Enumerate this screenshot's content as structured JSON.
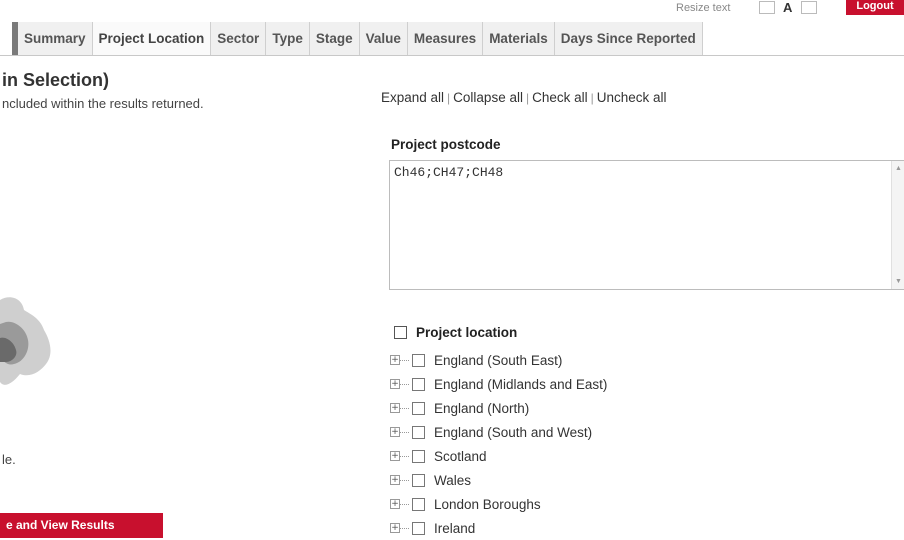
{
  "header": {
    "resize_label": "Resize text",
    "resize_a": "A",
    "logout_label": "Logout"
  },
  "tabs": [
    {
      "label": "Summary"
    },
    {
      "label": "Project Location"
    },
    {
      "label": "Sector"
    },
    {
      "label": "Type"
    },
    {
      "label": "Stage"
    },
    {
      "label": "Value"
    },
    {
      "label": "Measures"
    },
    {
      "label": "Materials"
    },
    {
      "label": "Days Since Reported"
    }
  ],
  "left": {
    "heading": "in Selection)",
    "subtext": "ncluded within the results returned.",
    "fragment": "le.",
    "button_label": "e and View Results"
  },
  "actions": {
    "expand": "Expand all",
    "collapse": "Collapse all",
    "check": "Check all",
    "uncheck": "Uncheck all",
    "sep": "|"
  },
  "postcode": {
    "label": "Project postcode",
    "value": "Ch46;CH47;CH48"
  },
  "location": {
    "title": "Project location",
    "regions": [
      {
        "label": "England (South East)"
      },
      {
        "label": "England (Midlands and East)"
      },
      {
        "label": "England (North)"
      },
      {
        "label": "England (South and West)"
      },
      {
        "label": "Scotland"
      },
      {
        "label": "Wales"
      },
      {
        "label": "London Boroughs"
      },
      {
        "label": "Ireland"
      }
    ]
  },
  "colors": {
    "brand_red": "#c8102e",
    "tab_bg": "#f0f0f0",
    "tab_text": "#555555"
  }
}
